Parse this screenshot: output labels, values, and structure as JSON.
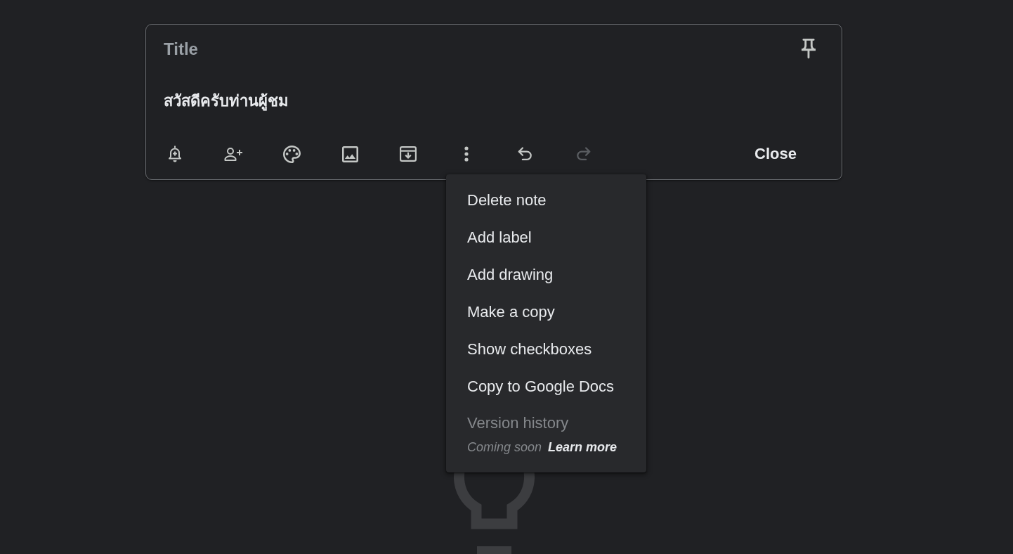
{
  "note": {
    "title": {
      "placeholder": "Title"
    },
    "body": {
      "value": "สวัสดีครับท่านผู้ชม"
    }
  },
  "toolbar": {
    "tools": [
      {
        "kind": "reminder",
        "disabled": false
      },
      {
        "kind": "collaborator",
        "disabled": false
      },
      {
        "kind": "palette",
        "disabled": false
      },
      {
        "kind": "image",
        "disabled": false
      },
      {
        "kind": "archive",
        "disabled": false
      },
      {
        "kind": "more",
        "disabled": false
      },
      {
        "kind": "undo",
        "disabled": false
      },
      {
        "kind": "redo",
        "disabled": true
      }
    ],
    "close_button": "Close"
  },
  "menu": {
    "items": [
      {
        "label": "Delete note",
        "disabled": false
      },
      {
        "label": "Add label",
        "disabled": false
      },
      {
        "label": "Add drawing",
        "disabled": false
      },
      {
        "label": "Make a copy",
        "disabled": false
      },
      {
        "label": "Show checkboxes",
        "disabled": false
      },
      {
        "label": "Copy to Google Docs",
        "disabled": false
      },
      {
        "label": "Version history",
        "disabled": true,
        "note": "Coming soon",
        "link": "Learn more"
      }
    ]
  }
}
